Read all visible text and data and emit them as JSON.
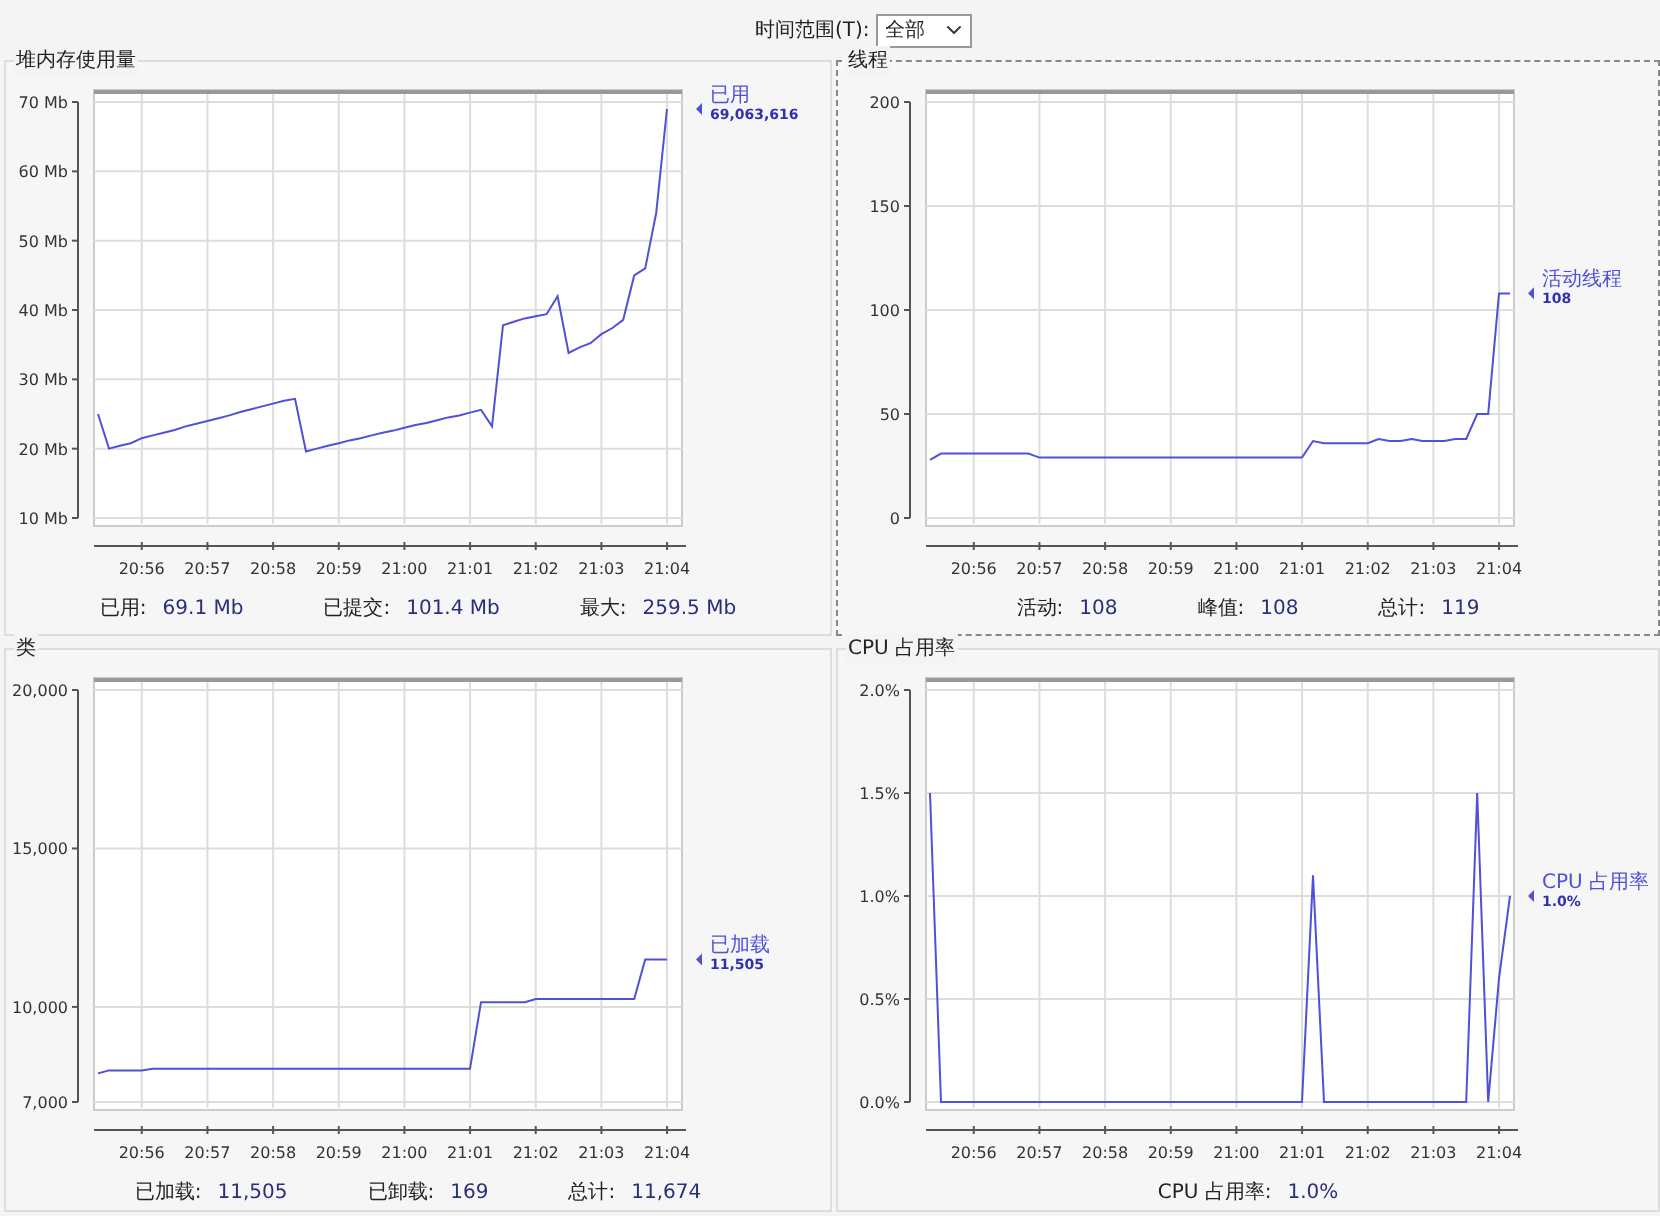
{
  "toolbar": {
    "label": "时间范围(T):",
    "time_range": "全部"
  },
  "panels": [
    {
      "title": "堆内存使用量",
      "focused": false,
      "legend": {
        "value": "69,063,616"
      },
      "stats": [
        {
          "label": "已用:",
          "value": "69.1  Mb"
        },
        {
          "label": "已提交:",
          "value": "101.4  Mb"
        },
        {
          "label": "最大:",
          "value": "259.5  Mb"
        }
      ],
      "chart_data": {
        "type": "line",
        "grid": true,
        "ylim": [
          10,
          70
        ],
        "categories": [
          null,
          null,
          null,
          null,
          "20:56",
          null,
          null,
          null,
          null,
          null,
          "20:57",
          null,
          null,
          null,
          null,
          null,
          "20:58",
          null,
          null,
          null,
          null,
          null,
          "20:59",
          null,
          null,
          null,
          null,
          null,
          "21:00",
          null,
          null,
          null,
          null,
          null,
          "21:01",
          null,
          null,
          null,
          null,
          null,
          "21:02",
          null,
          null,
          null,
          null,
          null,
          "21:03",
          null,
          null,
          null,
          null,
          null,
          "21:04",
          null
        ],
        "yticks": [
          {
            "value": 10,
            "label": "10 Mb"
          },
          {
            "value": 20,
            "label": "20 Mb"
          },
          {
            "value": 30,
            "label": "30 Mb"
          },
          {
            "value": 40,
            "label": "40 Mb"
          },
          {
            "value": 50,
            "label": "50 Mb"
          },
          {
            "value": 60,
            "label": "60 Mb"
          },
          {
            "value": 70,
            "label": "70 Mb"
          }
        ],
        "series": [
          {
            "name": "已用",
            "color": "#5050d8",
            "values": [
              25,
              20,
              20.4,
              20.8,
              21.5,
              21.9,
              22.3,
              22.7,
              23.2,
              23.6,
              24,
              24.4,
              24.8,
              25.3,
              25.7,
              26.1,
              26.5,
              26.9,
              27.2,
              19.6,
              20,
              20.4,
              20.8,
              21.2,
              21.5,
              21.9,
              22.3,
              22.6,
              23,
              23.4,
              23.7,
              24.1,
              24.5,
              24.8,
              25.2,
              25.6,
              23.2,
              37.8,
              38.3,
              38.8,
              39.1,
              39.4,
              42,
              33.8,
              34.6,
              35.2,
              36.5,
              37.4,
              38.6,
              45,
              46,
              54,
              69,
              null
            ]
          }
        ]
      }
    },
    {
      "title": "线程",
      "focused": true,
      "legend": {
        "value": "108"
      },
      "stats": [
        {
          "label": "活动:",
          "value": "108"
        },
        {
          "label": "峰值:",
          "value": "108"
        },
        {
          "label": "总计:",
          "value": "119"
        }
      ],
      "chart_data": {
        "type": "line",
        "grid": true,
        "ylim": [
          0,
          200
        ],
        "categories": [
          null,
          null,
          null,
          null,
          "20:56",
          null,
          null,
          null,
          null,
          null,
          "20:57",
          null,
          null,
          null,
          null,
          null,
          "20:58",
          null,
          null,
          null,
          null,
          null,
          "20:59",
          null,
          null,
          null,
          null,
          null,
          "21:00",
          null,
          null,
          null,
          null,
          null,
          "21:01",
          null,
          null,
          null,
          null,
          null,
          "21:02",
          null,
          null,
          null,
          null,
          null,
          "21:03",
          null,
          null,
          null,
          null,
          null,
          "21:04",
          null
        ],
        "yticks": [
          0,
          50,
          100,
          150,
          200
        ],
        "series": [
          {
            "name": "活动线程",
            "color": "#5050d8",
            "values": [
              28,
              31,
              31,
              31,
              31,
              31,
              31,
              31,
              31,
              31,
              29,
              29,
              29,
              29,
              29,
              29,
              29,
              29,
              29,
              29,
              29,
              29,
              29,
              29,
              29,
              29,
              29,
              29,
              29,
              29,
              29,
              29,
              29,
              29,
              29,
              37,
              36,
              36,
              36,
              36,
              36,
              38,
              37,
              37,
              38,
              37,
              37,
              37,
              38,
              38,
              50,
              50,
              108,
              108
            ]
          }
        ]
      }
    },
    {
      "title": "类",
      "focused": false,
      "legend": {
        "value": "11,505"
      },
      "stats": [
        {
          "label": "已加载:",
          "value": "11,505"
        },
        {
          "label": "已卸载:",
          "value": "169"
        },
        {
          "label": "总计:",
          "value": "11,674"
        }
      ],
      "chart_data": {
        "type": "line",
        "grid": true,
        "ylim": [
          7000,
          20000
        ],
        "categories": [
          null,
          null,
          null,
          null,
          "20:56",
          null,
          null,
          null,
          null,
          null,
          "20:57",
          null,
          null,
          null,
          null,
          null,
          "20:58",
          null,
          null,
          null,
          null,
          null,
          "20:59",
          null,
          null,
          null,
          null,
          null,
          "21:00",
          null,
          null,
          null,
          null,
          null,
          "21:01",
          null,
          null,
          null,
          null,
          null,
          "21:02",
          null,
          null,
          null,
          null,
          null,
          "21:03",
          null,
          null,
          null,
          null,
          null,
          "21:04",
          null
        ],
        "yticks": [
          {
            "value": 7000,
            "label": "7,000"
          },
          {
            "value": 10000,
            "label": "10,000"
          },
          {
            "value": 15000,
            "label": "15,000"
          },
          {
            "value": 20000,
            "label": "20,000"
          }
        ],
        "series": [
          {
            "name": "已加载",
            "color": "#5050d8",
            "values": [
              7900,
              8000,
              8000,
              8000,
              8000,
              8050,
              8050,
              8050,
              8050,
              8050,
              8050,
              8050,
              8050,
              8050,
              8050,
              8050,
              8050,
              8050,
              8050,
              8050,
              8050,
              8050,
              8050,
              8050,
              8050,
              8050,
              8050,
              8050,
              8050,
              8050,
              8050,
              8050,
              8050,
              8050,
              8050,
              10150,
              10150,
              10150,
              10150,
              10150,
              10250,
              10250,
              10250,
              10250,
              10250,
              10250,
              10250,
              10250,
              10250,
              10250,
              11500,
              11500,
              11500,
              null
            ]
          }
        ]
      }
    },
    {
      "title": "CPU 占用率",
      "focused": false,
      "legend": {
        "value": "1.0%"
      },
      "stats": [
        {
          "label": "CPU 占用率:",
          "value": "1.0%"
        }
      ],
      "chart_data": {
        "type": "line",
        "grid": true,
        "ylim": [
          0,
          2
        ],
        "categories": [
          null,
          null,
          null,
          null,
          "20:56",
          null,
          null,
          null,
          null,
          null,
          "20:57",
          null,
          null,
          null,
          null,
          null,
          "20:58",
          null,
          null,
          null,
          null,
          null,
          "20:59",
          null,
          null,
          null,
          null,
          null,
          "21:00",
          null,
          null,
          null,
          null,
          null,
          "21:01",
          null,
          null,
          null,
          null,
          null,
          "21:02",
          null,
          null,
          null,
          null,
          null,
          "21:03",
          null,
          null,
          null,
          null,
          null,
          "21:04",
          null
        ],
        "yticks": [
          {
            "value": 0,
            "label": "0.0%"
          },
          {
            "value": 0.5,
            "label": "0.5%"
          },
          {
            "value": 1,
            "label": "1.0%"
          },
          {
            "value": 1.5,
            "label": "1.5%"
          },
          {
            "value": 2,
            "label": "2.0%"
          }
        ],
        "series": [
          {
            "name": "CPU 占用率",
            "color": "#5050d8",
            "values": [
              1.5,
              0,
              0,
              0,
              0,
              0,
              0,
              0,
              0,
              0,
              0,
              0,
              0,
              0,
              0,
              0,
              0,
              0,
              0,
              0,
              0,
              0,
              0,
              0,
              0,
              0,
              0,
              0,
              0,
              0,
              0,
              0,
              0,
              0,
              0,
              1.1,
              0,
              0,
              0,
              0,
              0,
              0,
              0,
              0,
              0,
              0,
              0,
              0,
              0,
              0,
              1.5,
              0,
              0.6,
              1.0
            ]
          }
        ]
      }
    }
  ]
}
